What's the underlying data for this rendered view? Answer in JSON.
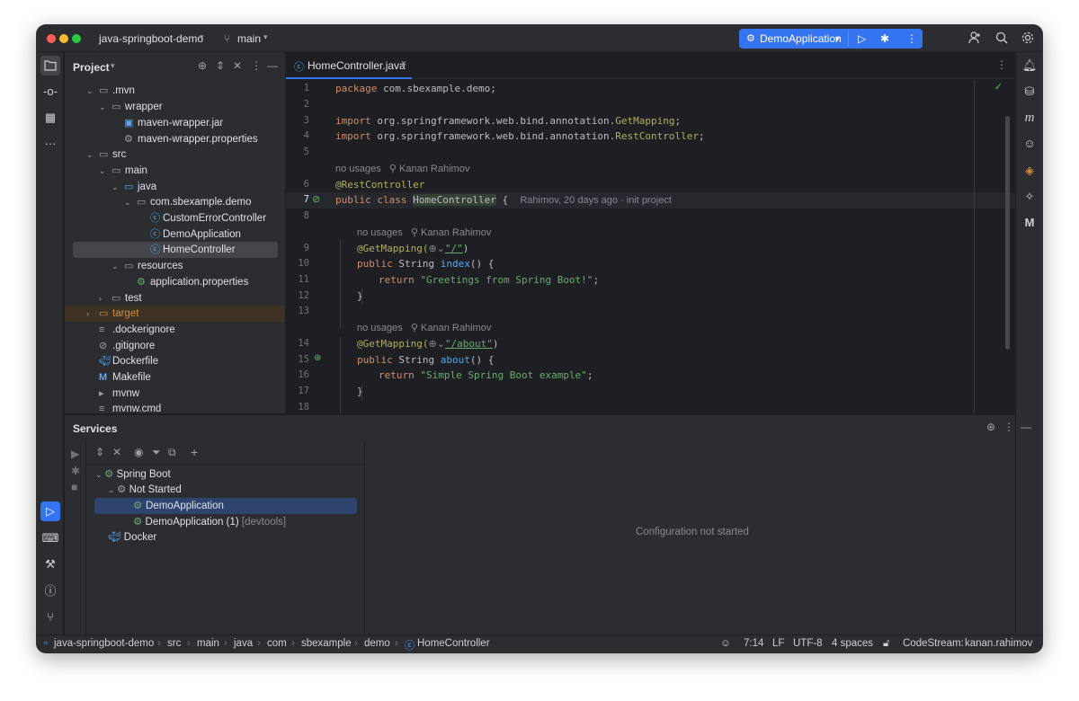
{
  "titlebar": {
    "project": "java-springboot-demo",
    "branch": "main",
    "run_config": "DemoApplication"
  },
  "project_panel": {
    "title": "Project",
    "tree": [
      {
        "label": ".mvn"
      },
      {
        "label": "wrapper"
      },
      {
        "label": "maven-wrapper.jar"
      },
      {
        "label": "maven-wrapper.properties"
      },
      {
        "label": "src"
      },
      {
        "label": "main"
      },
      {
        "label": "java"
      },
      {
        "label": "com.sbexample.demo"
      },
      {
        "label": "CustomErrorController"
      },
      {
        "label": "DemoApplication"
      },
      {
        "label": "HomeController"
      },
      {
        "label": "resources"
      },
      {
        "label": "application.properties"
      },
      {
        "label": "test"
      },
      {
        "label": "target"
      },
      {
        "label": ".dockerignore"
      },
      {
        "label": ".gitignore"
      },
      {
        "label": "Dockerfile"
      },
      {
        "label": "Makefile"
      },
      {
        "label": "mvnw"
      },
      {
        "label": "mvnw.cmd"
      }
    ]
  },
  "editor": {
    "tab": "HomeController.java",
    "line_numbers": [
      "1",
      "2",
      "3",
      "4",
      "5",
      "6",
      "7",
      "8",
      "9",
      "10",
      "11",
      "12",
      "13",
      "14",
      "15",
      "16",
      "17",
      "18"
    ],
    "code": {
      "l1_kw": "package",
      "l1_rest": " com.sbexample.demo;",
      "l3_kw": "import",
      "l3_pkg": " org.springframework.web.bind.annotation.",
      "l3_cls": "GetMapping",
      "l4_kw": "import",
      "l4_pkg": " org.springframework.web.bind.annotation.",
      "l4_cls": "RestController",
      "usages": "no usages",
      "author": "Kanan Rahimov",
      "l6_ann": "@RestController",
      "l7_kw1": "public",
      "l7_kw2": "class",
      "l7_name": "HomeController",
      "l7_brace": " {",
      "l7_blame": "Rahimov, 20 days ago · init project",
      "l9_ann": "@GetMapping(",
      "l9_path": "\"/\"",
      "l10_kw": "public",
      "l10_type": " String ",
      "l10_fn": "index",
      "l10_rest": "() {",
      "l11_kw": "return",
      "l11_str": "\"Greetings from Spring Boot!\"",
      "brace_close": "}",
      "l14_path": "\"/about\"",
      "l15_fn": "about",
      "l16_str": "\"Simple Spring Boot example\""
    }
  },
  "services": {
    "title": "Services",
    "tree": [
      {
        "label": "Spring Boot"
      },
      {
        "label": "Not Started"
      },
      {
        "label": "DemoApplication"
      },
      {
        "label": "DemoApplication (1)",
        "suffix": "[devtools]"
      },
      {
        "label": "Docker"
      }
    ],
    "empty_state": "Configuration not started"
  },
  "status_bar": {
    "breadcrumbs": [
      "java-springboot-demo",
      "src",
      "main",
      "java",
      "com",
      "sbexample",
      "demo",
      "HomeController"
    ],
    "position": "7:14",
    "line_ending": "LF",
    "encoding": "UTF-8",
    "indent": "4 spaces",
    "codestream": "CodeStream:",
    "codestream_user": "kanan.rahimov"
  },
  "colors": {
    "accent": "#3574f0",
    "keyword": "#cf8e6d",
    "annotation": "#b3ae60",
    "string": "#6aab73",
    "function": "#56a8f5",
    "excluded": "#d38d3c"
  }
}
